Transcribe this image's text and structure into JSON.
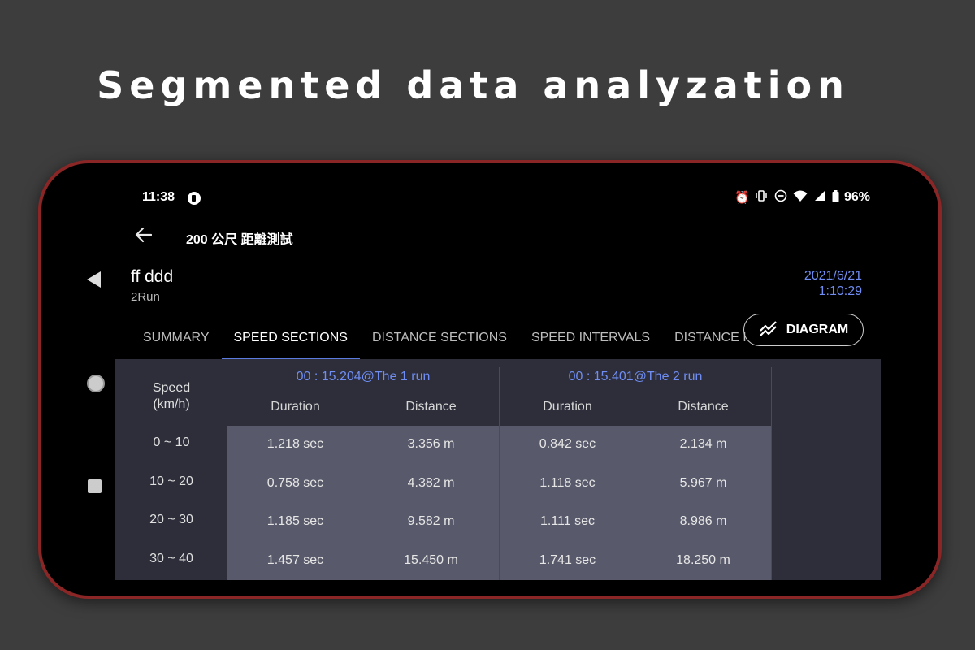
{
  "headline": "Segmented data analyzation",
  "status_bar": {
    "time": "11:38",
    "battery": "96%",
    "icons": [
      "alarm-icon",
      "vibrate-icon",
      "dnd-icon",
      "wifi-icon",
      "signal-icon",
      "battery-icon"
    ]
  },
  "app_bar": {
    "title": "200 公尺 距離測試"
  },
  "header": {
    "name": "ff ddd",
    "subtitle": "2Run",
    "date": "2021/6/21",
    "time": "1:10:29"
  },
  "tabs": [
    {
      "label": "SUMMARY",
      "active": false
    },
    {
      "label": "SPEED SECTIONS",
      "active": true
    },
    {
      "label": "DISTANCE SECTIONS",
      "active": false
    },
    {
      "label": "SPEED INTERVALS",
      "active": false
    },
    {
      "label": "DISTANCE I",
      "active": false
    }
  ],
  "diagram_button": {
    "label": "DIAGRAM"
  },
  "table": {
    "speed_header_line1": "Speed",
    "speed_header_line2": "(km/h)",
    "speed_ranges": [
      "0 ~ 10",
      "10 ~ 20",
      "20 ~ 30",
      "30 ~ 40"
    ],
    "runs": [
      {
        "header": "00 : 15.204@The 1 run",
        "duration_label": "Duration",
        "distance_label": "Distance",
        "durations": [
          "1.218 sec",
          "0.758 sec",
          "1.185 sec",
          "1.457 sec"
        ],
        "distances": [
          "3.356 m",
          "4.382 m",
          "9.582 m",
          "15.450 m"
        ]
      },
      {
        "header": "00 : 15.401@The 2 run",
        "duration_label": "Duration",
        "distance_label": "Distance",
        "durations": [
          "0.842 sec",
          "1.118 sec",
          "1.111 sec",
          "1.741 sec"
        ],
        "distances": [
          "2.134 m",
          "5.967 m",
          "8.986 m",
          "18.250 m"
        ]
      }
    ]
  },
  "colors": {
    "accent": "#6f8df2",
    "frame": "#8b2626",
    "cell_bg": "#585a6b",
    "table_bg": "#2d2e3a"
  }
}
